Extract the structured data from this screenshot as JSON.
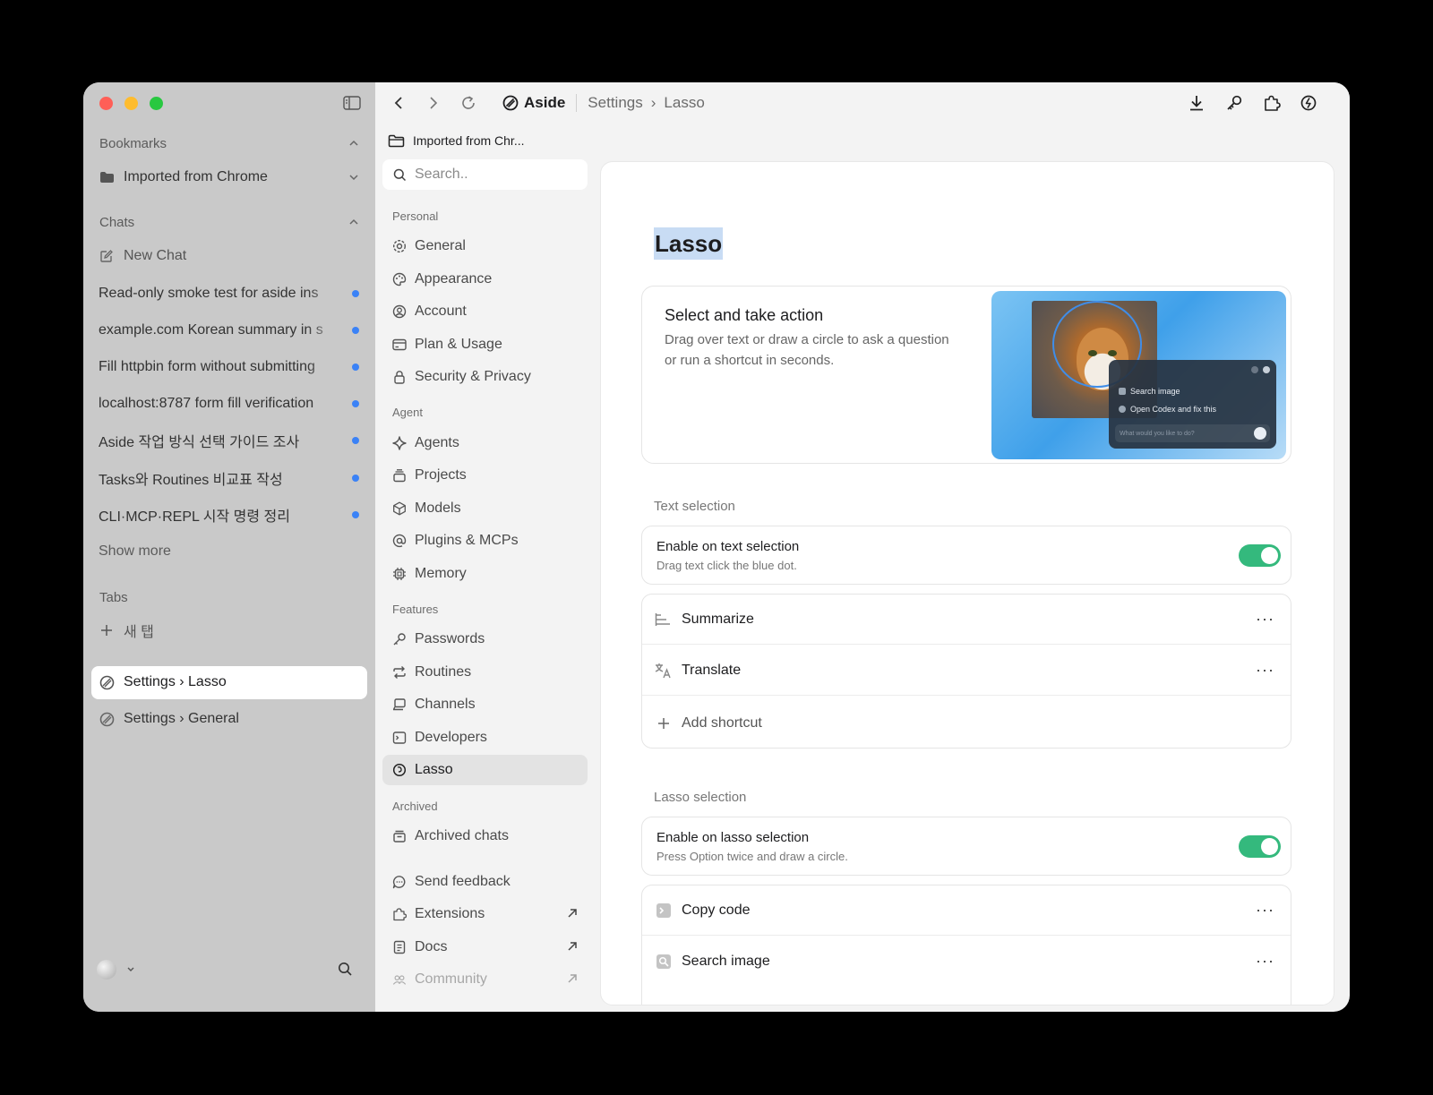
{
  "sidebar": {
    "bookmarks_label": "Bookmarks",
    "bookmark_folder": "Imported from Chrome",
    "chats_label": "Chats",
    "new_chat": "New Chat",
    "chats": [
      "Read-only smoke test for aside ins",
      "example.com Korean summary in s",
      "Fill httpbin form without submitting",
      "localhost:8787 form fill verification",
      "Aside 작업 방식 선택 가이드 조사",
      "Tasks와 Routines 비교표 작성",
      "CLI·MCP·REPL 시작 명령 정리"
    ],
    "show_more": "Show more",
    "tabs_label": "Tabs",
    "new_tab": "새 탭",
    "tabs": [
      {
        "label": "Settings › Lasso",
        "active": true
      },
      {
        "label": "Settings › General",
        "active": false
      }
    ]
  },
  "topbar": {
    "brand": "Aside",
    "crumb_1": "Settings",
    "crumb_sep": "›",
    "crumb_2": "Lasso"
  },
  "bookmark_bar": {
    "folder": "Imported from Chr..."
  },
  "settings_nav": {
    "search_placeholder": "Search..",
    "personal_label": "Personal",
    "personal": [
      "General",
      "Appearance",
      "Account",
      "Plan & Usage",
      "Security & Privacy"
    ],
    "agent_label": "Agent",
    "agent": [
      "Agents",
      "Projects",
      "Models",
      "Plugins & MCPs",
      "Memory"
    ],
    "features_label": "Features",
    "features": [
      "Passwords",
      "Routines",
      "Channels",
      "Developers",
      "Lasso"
    ],
    "archived_label": "Archived",
    "archived": [
      "Archived chats"
    ],
    "bottom": [
      "Send feedback",
      "Extensions",
      "Docs",
      "Community"
    ]
  },
  "content": {
    "title": "Lasso",
    "hero": {
      "title": "Select and take action",
      "description": "Drag over text or draw a circle to ask a question or run a shortcut in seconds.",
      "popup_item_1": "Search image",
      "popup_item_2": "Open Codex and fix this",
      "popup_placeholder": "What would you like to do?"
    },
    "text_selection": {
      "label": "Text selection",
      "toggle_title": "Enable on text selection",
      "toggle_desc": "Drag text click the blue dot.",
      "enabled": true,
      "shortcuts": [
        "Summarize",
        "Translate"
      ],
      "add_shortcut": "Add shortcut"
    },
    "lasso_selection": {
      "label": "Lasso selection",
      "toggle_title": "Enable on lasso selection",
      "toggle_desc": "Press Option twice and draw a circle.",
      "enabled": true,
      "shortcuts": [
        "Copy code",
        "Search image"
      ]
    },
    "more_glyph": "···"
  },
  "colors": {
    "toggle_on": "#34b97d",
    "unread_dot": "#3b82f6",
    "title_highlight": "#c8dcf4"
  }
}
